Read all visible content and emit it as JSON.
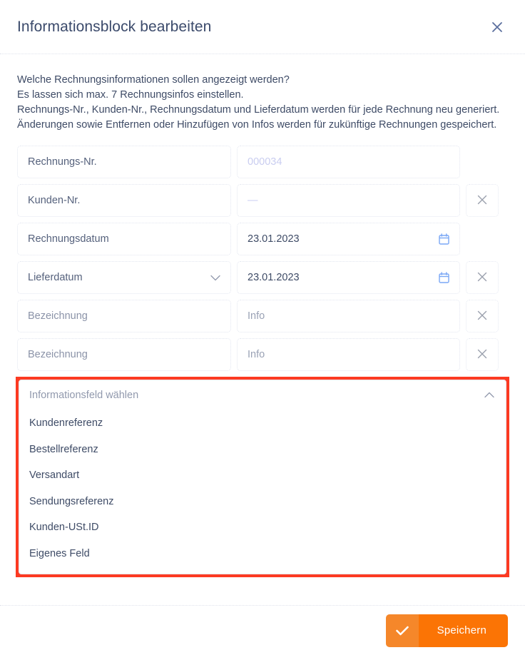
{
  "header": {
    "title": "Informationsblock bearbeiten",
    "close_icon": "close-icon"
  },
  "intro": {
    "lines": [
      "Welche Rechnungsinformationen sollen angezeigt werden?",
      "Es lassen sich max. 7 Rechnungsinfos einstellen.",
      "Rechnungs-Nr., Kunden-Nr., Rechnungsdatum und Lieferdatum werden für jede Rechnung neu generiert.",
      "Änderungen sowie Entfernen oder Hinzufügen von Infos werden für zukünftige Rechnungen gespeichert."
    ]
  },
  "rows": [
    {
      "label": "Rechnungs-Nr.",
      "label_is_placeholder": false,
      "label_has_chevron": false,
      "value": "000034",
      "value_style": "ph",
      "value_has_calendar": false,
      "removable": false
    },
    {
      "label": "Kunden-Nr.",
      "label_is_placeholder": false,
      "label_has_chevron": false,
      "value": "—",
      "value_style": "dash",
      "value_has_calendar": false,
      "removable": true
    },
    {
      "label": "Rechnungsdatum",
      "label_is_placeholder": false,
      "label_has_chevron": false,
      "value": "23.01.2023",
      "value_style": "normal",
      "value_has_calendar": true,
      "removable": false
    },
    {
      "label": "Lieferdatum",
      "label_is_placeholder": false,
      "label_has_chevron": true,
      "value": "23.01.2023",
      "value_style": "normal",
      "value_has_calendar": true,
      "removable": true
    },
    {
      "label": "Bezeichnung",
      "label_is_placeholder": true,
      "label_has_chevron": false,
      "value": "Info",
      "value_style": "ph-grey",
      "value_has_calendar": false,
      "removable": true
    },
    {
      "label": "Bezeichnung",
      "label_is_placeholder": true,
      "label_has_chevron": false,
      "value": "Info",
      "value_style": "ph-grey",
      "value_has_calendar": false,
      "removable": true
    }
  ],
  "dropdown": {
    "highlighted": true,
    "highlight_color": "#fc3a22",
    "trigger_label": "Informationsfeld wählen",
    "expanded": true,
    "chevron_icon": "chevron-up-icon",
    "options": [
      "Kundenreferenz",
      "Bestellreferenz",
      "Versandart",
      "Sendungsreferenz",
      "Kunden-USt.ID",
      "Eigenes Feld"
    ]
  },
  "footer": {
    "save_label": "Speichern",
    "save_icon": "check-icon",
    "save_color": "#fb7405",
    "save_icon_color": "#f5872a"
  }
}
